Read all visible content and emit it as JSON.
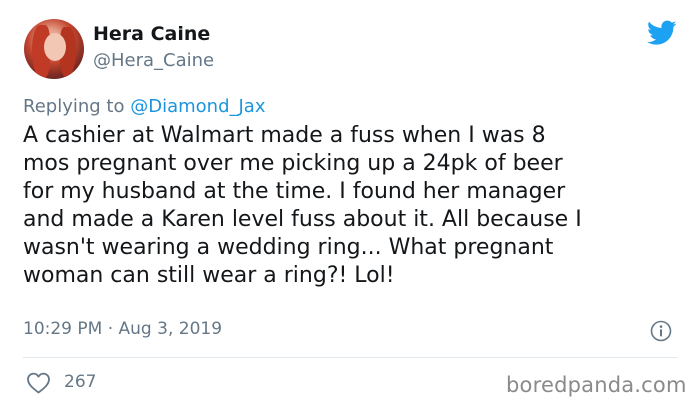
{
  "author": {
    "display_name": "Hera Caine",
    "handle": "@Hera_Caine"
  },
  "reply": {
    "prefix": "Replying to",
    "mention": "@Diamond_Jax"
  },
  "tweet": {
    "lines": [
      "A cashier at Walmart made a fuss when I was 8",
      "mos pregnant over me picking up a 24pk of beer",
      "for my husband at the time. I found her manager",
      "and made a Karen level fuss about it. All because I",
      "wasn't wearing a wedding ring... What pregnant",
      "woman can still wear a ring?! Lol!"
    ],
    "timestamp": "10:29 PM · Aug 3, 2019"
  },
  "stats": {
    "likes": "267"
  },
  "watermark": "boredpanda.com",
  "icons": {
    "brand": "twitter-bird-icon",
    "info": "info-icon",
    "like": "heart-icon"
  },
  "colors": {
    "twitter_blue": "#1da1f2",
    "link_blue": "#1b95e0",
    "muted_gray": "#657786",
    "text": "#14171a"
  }
}
